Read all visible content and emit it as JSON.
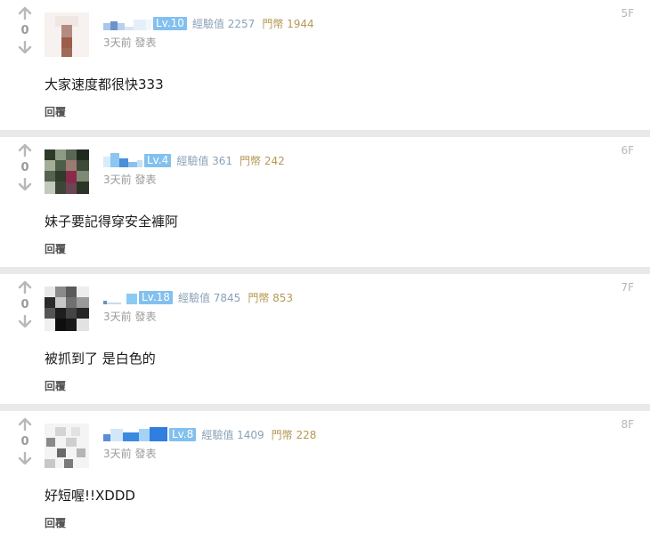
{
  "comments": [
    {
      "votes": "0",
      "level": "Lv.10",
      "exp": "經驗值 2257",
      "coins": "門幣 1944",
      "time": "3天前 發表",
      "text": "大家速度都很快333",
      "reply": "回覆",
      "floor": "5F"
    },
    {
      "votes": "0",
      "level": "Lv.4",
      "exp": "經驗值 361",
      "coins": "門幣 242",
      "time": "3天前 發表",
      "text": "妹子要記得穿安全褲阿",
      "reply": "回覆",
      "floor": "6F"
    },
    {
      "votes": "0",
      "level": "Lv.18",
      "exp": "經驗值 7845",
      "coins": "門幣 853",
      "time": "3天前 發表",
      "text": "被抓到了 是白色的",
      "reply": "回覆",
      "floor": "7F"
    },
    {
      "votes": "0",
      "level": "Lv.8",
      "exp": "經驗值 1409",
      "coins": "門幣 228",
      "time": "3天前 發表",
      "text": "好短喔!!XDDD",
      "reply": "回覆",
      "floor": "8F"
    }
  ],
  "colors": {
    "level_badge": "#82c0ef",
    "exp_text": "#8aa2b6",
    "coin_text": "#b59a55",
    "muted": "#9a9a9a",
    "page_bg": "#e9e9e9"
  },
  "icons": {
    "upvote": "arrow-up-icon",
    "downvote": "arrow-down-icon"
  }
}
